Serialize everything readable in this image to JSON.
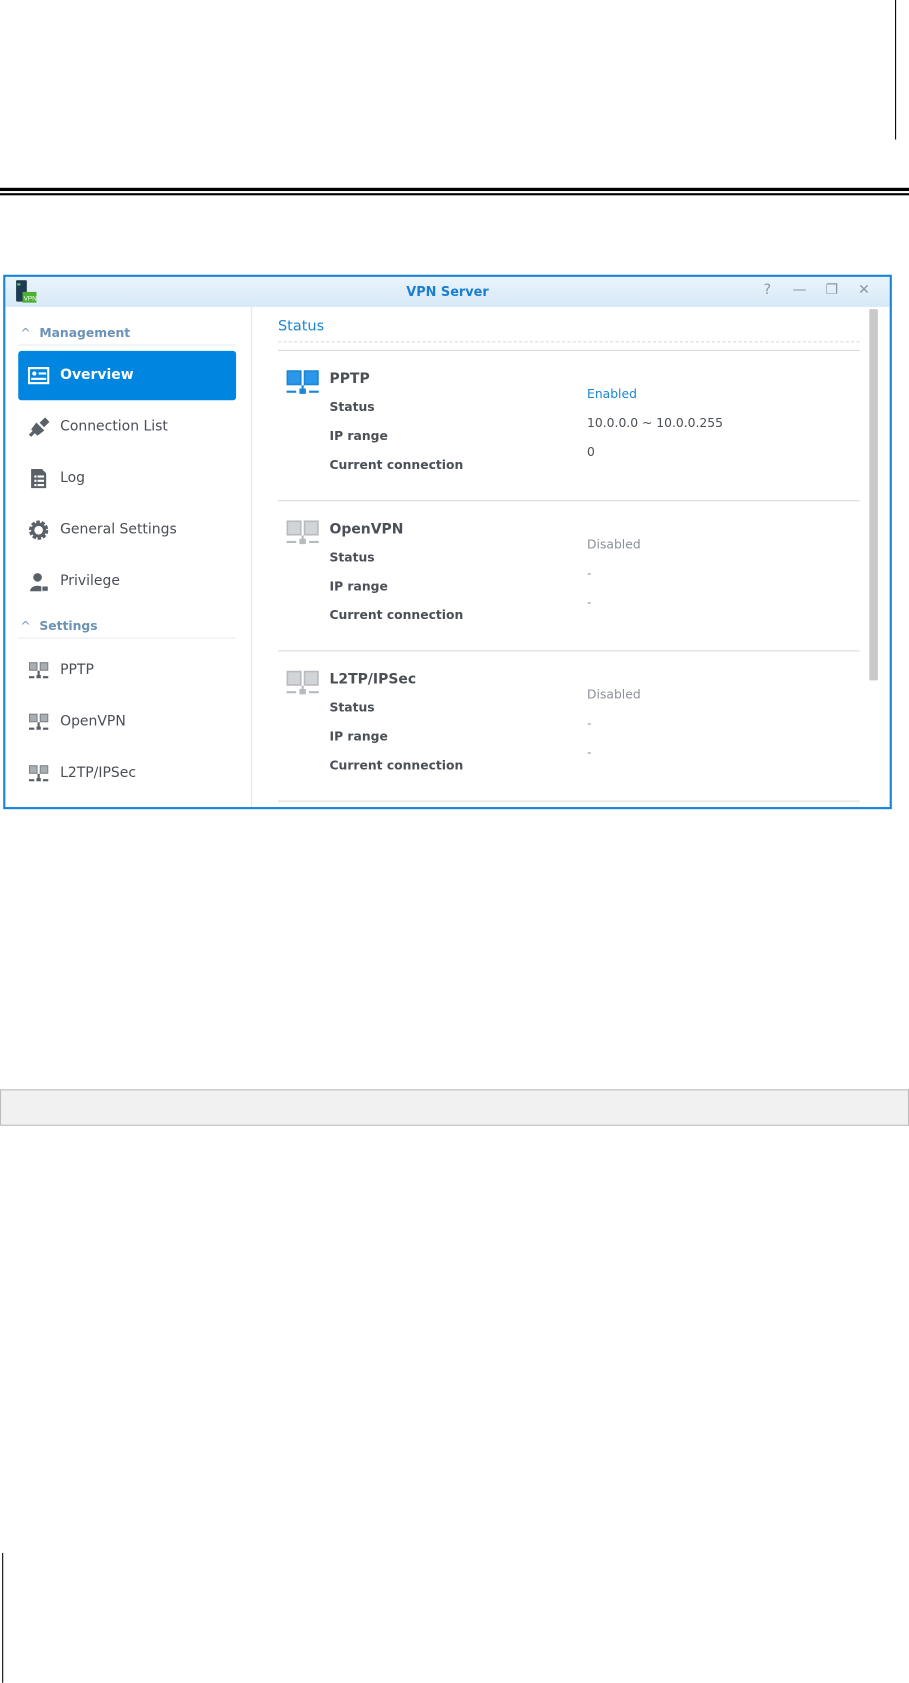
{
  "window": {
    "title": "VPN Server",
    "buttons": [
      "?",
      "—",
      "❐",
      "✕"
    ]
  },
  "sidebar": {
    "sections": [
      {
        "label": "Management",
        "items": [
          {
            "label": "Overview",
            "icon": "overview-icon",
            "active": true
          },
          {
            "label": "Connection List",
            "icon": "plug-icon"
          },
          {
            "label": "Log",
            "icon": "log-icon"
          },
          {
            "label": "General Settings",
            "icon": "gear-icon"
          },
          {
            "label": "Privilege",
            "icon": "user-lock-icon"
          }
        ]
      },
      {
        "label": "Settings",
        "items": [
          {
            "label": "PPTP",
            "icon": "network-icon"
          },
          {
            "label": "OpenVPN",
            "icon": "network-icon"
          },
          {
            "label": "L2TP/IPSec",
            "icon": "network-icon"
          }
        ]
      }
    ]
  },
  "content": {
    "heading": "Status",
    "labels": {
      "status": "Status",
      "ip_range": "IP range",
      "current_connection": "Current connection"
    },
    "protocols": [
      {
        "name": "PPTP",
        "status": "Enabled",
        "ip_range": "10.0.0.0 ~ 10.0.0.255",
        "current_connection": "0"
      },
      {
        "name": "OpenVPN",
        "status": "Disabled",
        "ip_range": "-",
        "current_connection": "-"
      },
      {
        "name": "L2TP/IPSec",
        "status": "Disabled",
        "ip_range": "-",
        "current_connection": "-"
      }
    ]
  },
  "colors": {
    "accent": "#0086e0",
    "enabled": "#1a86d6",
    "disabled": "#8b9198"
  }
}
